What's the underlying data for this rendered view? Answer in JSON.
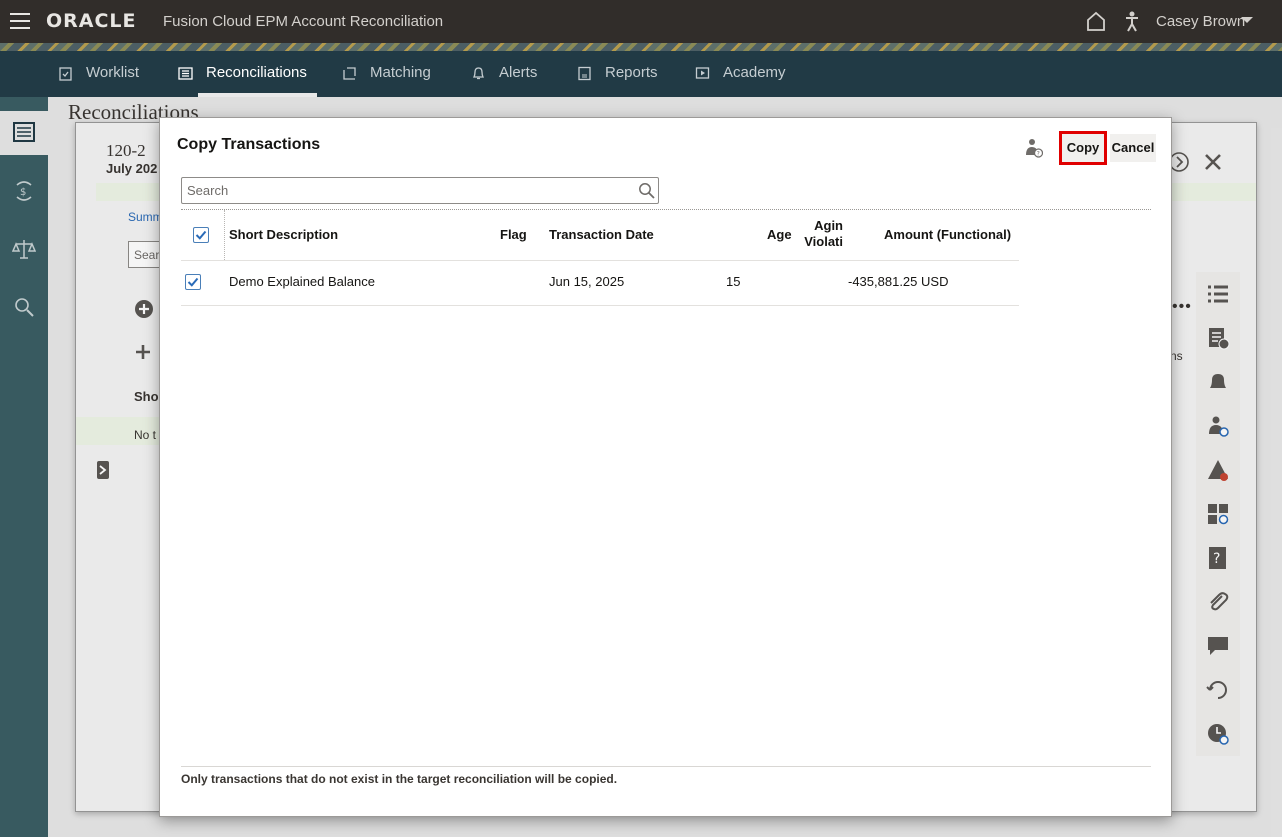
{
  "header": {
    "logo": "ORACLE",
    "product": "Fusion Cloud EPM Account Reconciliation",
    "user": "Casey Brown"
  },
  "nav": {
    "tabs": [
      {
        "label": "Worklist",
        "icon": "clipboard-icon"
      },
      {
        "label": "Reconciliations",
        "icon": "list-icon",
        "active": true
      },
      {
        "label": "Matching",
        "icon": "matching-icon"
      },
      {
        "label": "Alerts",
        "icon": "bell-icon"
      },
      {
        "label": "Reports",
        "icon": "report-icon"
      },
      {
        "label": "Academy",
        "icon": "play-icon"
      }
    ]
  },
  "background": {
    "page_title": "Reconciliations",
    "recon_id": "120-2",
    "period": "July 202",
    "summary_link": "Summ",
    "search_stub": "Sear",
    "column_stub": "Shor",
    "empty_stub": "No t",
    "trailing_stub": "ns"
  },
  "dialog": {
    "title": "Copy Transactions",
    "copy_label": "Copy",
    "cancel_label": "Cancel",
    "search_placeholder": "Search",
    "columns": {
      "short_description": "Short Description",
      "flag": "Flag",
      "transaction_date": "Transaction Date",
      "age": "Age",
      "aging_violation_1": "Agin",
      "aging_violation_2": "Violati",
      "amount": "Amount (Functional)"
    },
    "rows": [
      {
        "selected": true,
        "short_description": "Demo Explained Balance",
        "flag": "",
        "transaction_date": "Jun 15, 2025",
        "age": "15",
        "amount": "-435,881.25 USD"
      }
    ],
    "footer_note": "Only transactions that do not exist in the target reconciliation will be copied."
  },
  "colors": {
    "header_bg": "#312d2a",
    "nav_bg": "#213a45",
    "rail_bg": "#3b5e64",
    "checkbox_blue": "#2a6bb8",
    "highlight_red": "#e00000"
  }
}
